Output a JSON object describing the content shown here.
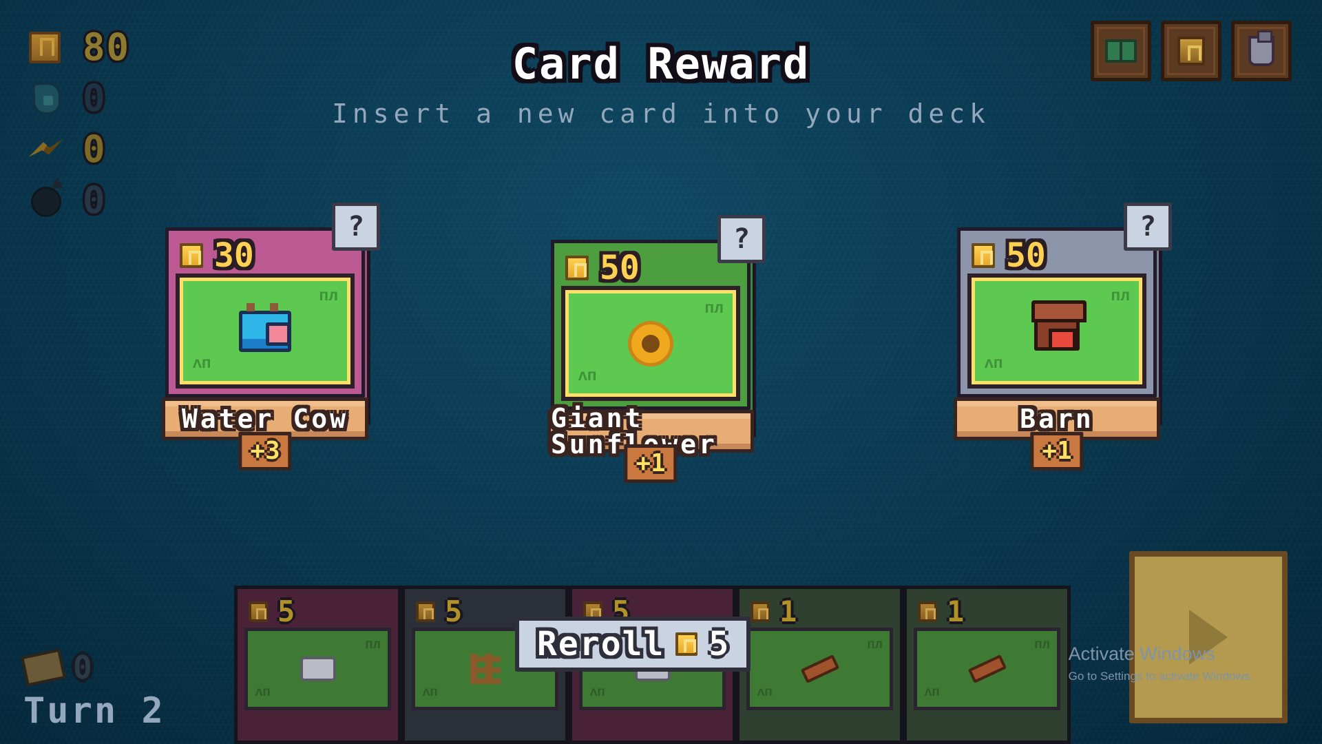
{
  "header": {
    "title": "Card Reward",
    "subtitle": "Insert a new card into your deck"
  },
  "resources": [
    {
      "icon": "coin-icon",
      "value": "80"
    },
    {
      "icon": "water-drop-icon",
      "value": "0"
    },
    {
      "icon": "lightning-icon",
      "value": "0"
    },
    {
      "icon": "bomb-icon",
      "value": "0"
    }
  ],
  "item_slots": [
    {
      "icon": "book-item-icon"
    },
    {
      "icon": "coin-item-icon"
    },
    {
      "icon": "flask-item-icon"
    }
  ],
  "reward_cards": [
    {
      "name": "Water Cow",
      "cost": "30",
      "bonus": "+3",
      "help": "?",
      "sprite": "cow-sprite",
      "frame_color": "#bd5a93"
    },
    {
      "name": "Giant Sunflower",
      "cost": "50",
      "bonus": "+1",
      "help": "?",
      "sprite": "sunflower-sprite",
      "frame_color": "#4d9e3f"
    },
    {
      "name": "Barn",
      "cost": "50",
      "bonus": "+1",
      "help": "?",
      "sprite": "barn-sprite",
      "frame_color": "#8d95ab"
    }
  ],
  "hand": [
    {
      "cost": "5",
      "sprite": "sheep-sprite",
      "bg": "#4a2238"
    },
    {
      "cost": "5",
      "sprite": "fence-sprite",
      "bg": "#2b2f38"
    },
    {
      "cost": "5",
      "sprite": "sheep-sprite",
      "bg": "#4a2238"
    },
    {
      "cost": "1",
      "sprite": "log-sprite",
      "bg": "#2f4030"
    },
    {
      "cost": "1",
      "sprite": "log-sprite",
      "bg": "#2f4030"
    }
  ],
  "reroll": {
    "label": "Reroll",
    "cost": "5"
  },
  "turn": {
    "label": "Turn",
    "count": "2",
    "deck_count": "0"
  },
  "end_turn": {
    "icon": "arrow-right-icon"
  },
  "watermark": {
    "line1": "Activate Windows",
    "line2": "Go to Settings to activate Windows."
  },
  "colors": {
    "background": "#0a3b53",
    "accent_gold": "#ffd152",
    "card_art": "#5ec950",
    "banner": "#e8ac75"
  }
}
